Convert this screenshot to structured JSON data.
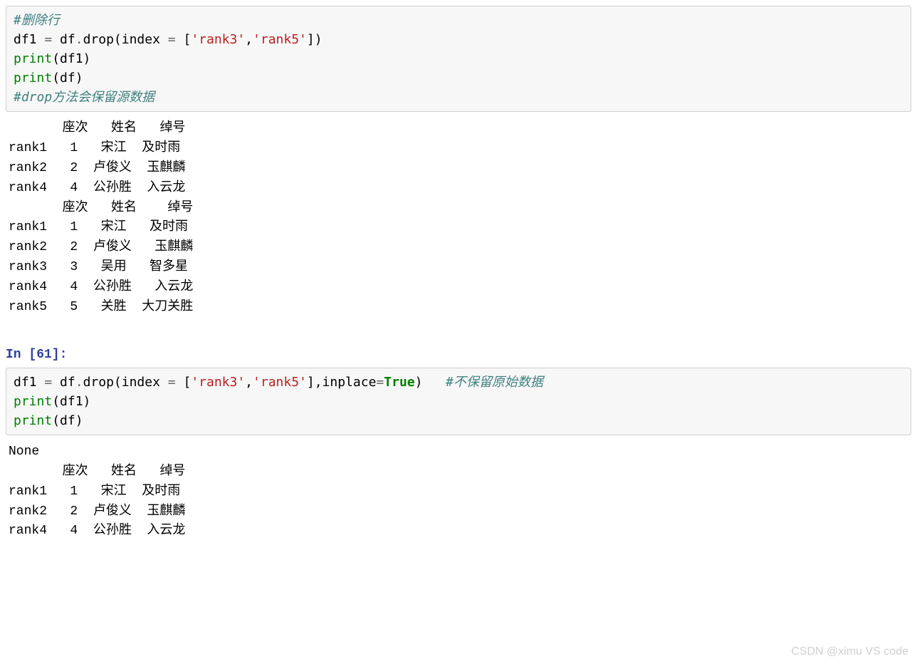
{
  "cell1": {
    "comment1": "#删除行",
    "line2_left": "df1 ",
    "line2_op": "=",
    "line2_mid": " df",
    "line2_dot": ".",
    "line2_call": "drop(index ",
    "line2_eq": "=",
    "line2_sp": " [",
    "line2_str1": "'rank3'",
    "line2_comma": ",",
    "line2_str2": "'rank5'",
    "line2_end": "])",
    "line3_pre": "print",
    "line3_arg": "(df1)",
    "line4_pre": "print",
    "line4_arg": "(df)",
    "comment2": "#drop方法会保留源数据"
  },
  "output1": "       座次   姓名   绰号\nrank1   1   宋江  及时雨\nrank2   2  卢俊义  玉麒麟\nrank4   4  公孙胜  入云龙\n       座次   姓名    绰号\nrank1   1   宋江   及时雨\nrank2   2  卢俊义   玉麒麟\nrank3   3   吴用   智多星\nrank4   4  公孙胜   入云龙\nrank5   5   关胜  大刀关胜",
  "prompt2": "In [61]:",
  "cell2": {
    "line1_left": "df1 ",
    "line1_op": "=",
    "line1_mid": " df",
    "line1_dot": ".",
    "line1_call": "drop(index ",
    "line1_eq": "=",
    "line1_sp": " [",
    "line1_str1": "'rank3'",
    "line1_comma": ",",
    "line1_str2": "'rank5'",
    "line1_close": "],inplace",
    "line1_eq2": "=",
    "line1_kw": "True",
    "line1_end": ")   ",
    "line1_comment": "#不保留原始数据",
    "line2_pre": "print",
    "line2_arg": "(df1)",
    "line3_pre": "print",
    "line3_arg": "(df)"
  },
  "output2": "None\n       座次   姓名   绰号\nrank1   1   宋江  及时雨\nrank2   2  卢俊义  玉麒麟\nrank4   4  公孙胜  入云龙",
  "watermark": "CSDN @ximu VS code"
}
